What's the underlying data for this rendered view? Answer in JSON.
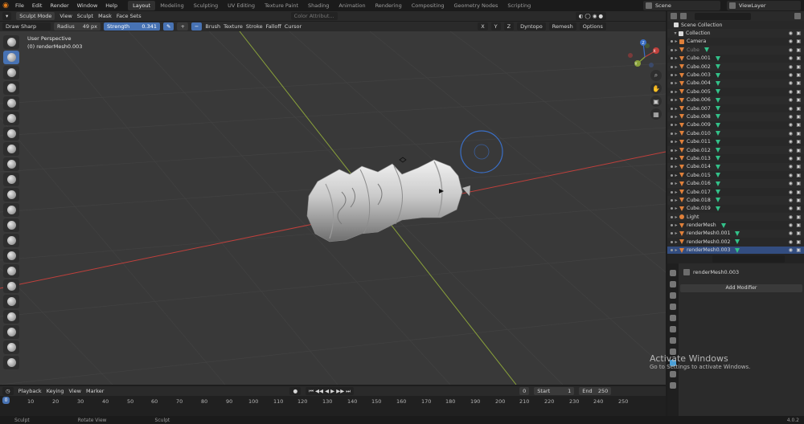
{
  "topbar": {
    "menu": [
      "File",
      "Edit",
      "Render",
      "Window",
      "Help"
    ],
    "workspaces": [
      "Layout",
      "Modeling",
      "Sculpting",
      "UV Editing",
      "Texture Paint",
      "Shading",
      "Animation",
      "Rendering",
      "Compositing",
      "Geometry Nodes",
      "Scripting"
    ],
    "active_workspace": "Layout",
    "scene": "Scene",
    "view_layer": "ViewLayer"
  },
  "viewport_header": {
    "mode": "Sculpt Mode",
    "menus": [
      "View",
      "Sculpt",
      "Mask",
      "Face Sets"
    ],
    "color_attribute": "Color Attribut..."
  },
  "tool_header": {
    "brush": "Draw Sharp",
    "radius_label": "Radius",
    "radius_value": "49 px",
    "strength_label": "Strength",
    "strength_value": "0.341",
    "menus": [
      "Brush",
      "Texture",
      "Stroke",
      "Falloff",
      "Cursor"
    ],
    "axes": [
      "X",
      "Y",
      "Z"
    ],
    "dyntopo": "Dyntopo",
    "remesh": "Remesh",
    "options": "Options"
  },
  "viewport": {
    "perspective": "User Perspective",
    "object": "(0) renderMesh0.003",
    "gizmo_axes": [
      "X",
      "Y",
      "Z"
    ]
  },
  "timeline": {
    "menus": [
      "Playback",
      "Keying",
      "View",
      "Marker"
    ],
    "current_frame": "0",
    "start_label": "Start",
    "start_value": "1",
    "end_label": "End",
    "end_value": "250",
    "ruler": [
      "0",
      "10",
      "20",
      "30",
      "40",
      "50",
      "60",
      "70",
      "80",
      "90",
      "100",
      "110",
      "120",
      "130",
      "140",
      "150",
      "160",
      "170",
      "180",
      "190",
      "200",
      "210",
      "220",
      "230",
      "240",
      "250"
    ]
  },
  "statusbar": [
    "Sculpt",
    "Rotate View",
    "Sculpt"
  ],
  "version": "4.0.2",
  "watermark": {
    "title": "Activate Windows",
    "subtitle": "Go to Settings to activate Windows."
  },
  "outliner": {
    "scene_collection": "Scene Collection",
    "collection": "Collection",
    "rows": [
      {
        "name": "Camera",
        "type": "cam"
      },
      {
        "name": "Cube",
        "type": "mesh",
        "dim": true
      },
      {
        "name": "Cube.001",
        "type": "mesh"
      },
      {
        "name": "Cube.002",
        "type": "mesh"
      },
      {
        "name": "Cube.003",
        "type": "mesh"
      },
      {
        "name": "Cube.004",
        "type": "mesh"
      },
      {
        "name": "Cube.005",
        "type": "mesh"
      },
      {
        "name": "Cube.006",
        "type": "mesh"
      },
      {
        "name": "Cube.007",
        "type": "mesh"
      },
      {
        "name": "Cube.008",
        "type": "mesh"
      },
      {
        "name": "Cube.009",
        "type": "mesh"
      },
      {
        "name": "Cube.010",
        "type": "mesh"
      },
      {
        "name": "Cube.011",
        "type": "mesh"
      },
      {
        "name": "Cube.012",
        "type": "mesh"
      },
      {
        "name": "Cube.013",
        "type": "mesh"
      },
      {
        "name": "Cube.014",
        "type": "mesh"
      },
      {
        "name": "Cube.015",
        "type": "mesh"
      },
      {
        "name": "Cube.016",
        "type": "mesh"
      },
      {
        "name": "Cube.017",
        "type": "mesh"
      },
      {
        "name": "Cube.018",
        "type": "mesh"
      },
      {
        "name": "Cube.019",
        "type": "mesh"
      },
      {
        "name": "Light",
        "type": "light"
      },
      {
        "name": "renderMesh",
        "type": "mesh"
      },
      {
        "name": "renderMesh0.001",
        "type": "mesh"
      },
      {
        "name": "renderMesh0.002",
        "type": "mesh"
      },
      {
        "name": "renderMesh0.003",
        "type": "mesh",
        "selected": true
      }
    ]
  },
  "properties": {
    "object_name": "renderMesh0.003",
    "add_modifier": "Add Modifier"
  },
  "colors": {
    "accent": "#4772b3",
    "viewport_bg": "#393939",
    "x_axis": "#c0403c",
    "y_axis": "#8aa23a",
    "brush_circle": "#3a6fc6"
  }
}
